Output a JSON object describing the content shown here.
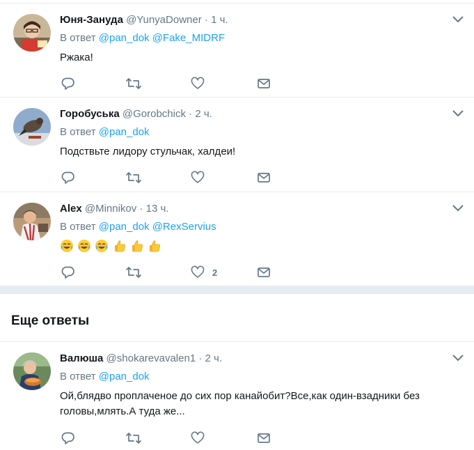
{
  "replies": [
    {
      "name": "Юня-Зануда",
      "handle": "@YunyaDowner",
      "dot": "·",
      "time": "1 ч.",
      "reply_prefix": "В ответ",
      "mentions": [
        "@pan_dok",
        "@Fake_MIDRF"
      ],
      "text": "Ржака!",
      "like_count": ""
    },
    {
      "name": "Горобуська",
      "handle": "@Gorobchick",
      "dot": "·",
      "time": "2 ч.",
      "reply_prefix": "В ответ",
      "mentions": [
        "@pan_dok"
      ],
      "text": "Подствьте лидору стульчак, халдеи!",
      "like_count": ""
    },
    {
      "name": "Alex",
      "handle": "@Minnikov",
      "dot": "·",
      "time": "13 ч.",
      "reply_prefix": "В ответ",
      "mentions": [
        "@pan_dok",
        "@RexServius"
      ],
      "text": "😂😂😂👍👍👍",
      "like_count": "2"
    }
  ],
  "more_replies": {
    "title": "Еще ответы",
    "items": [
      {
        "name": "Валюша",
        "handle": "@shokarevavalen1",
        "dot": "·",
        "time": "2 ч.",
        "reply_prefix": "В ответ",
        "mentions": [
          "@pan_dok"
        ],
        "text_line1": "Ой,блядво проплаченое до сих пор канайобит?Все,как один-взадники без",
        "text_line2": "головы,млять.А туда же...",
        "like_count": ""
      }
    ]
  },
  "icons": {
    "reply": "reply-icon",
    "retweet": "retweet-icon",
    "like": "heart-icon",
    "dm": "envelope-icon",
    "menu": "chevron-down-icon"
  },
  "colors": {
    "link": "#1da1f2",
    "secondary": "#657786",
    "divider": "#e6ecf0"
  }
}
